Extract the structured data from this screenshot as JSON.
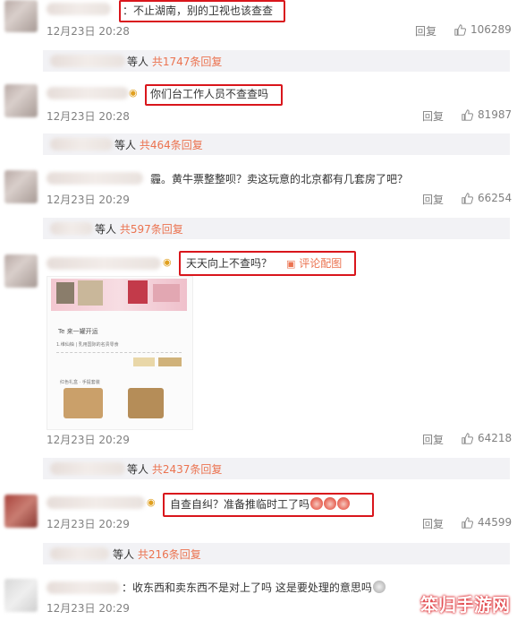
{
  "comments": [
    {
      "text": "：不止湖南，别的卫视也该查查",
      "time": "12月23日 20:28",
      "reply": "回复",
      "likes": "106289",
      "sub": {
        "suffix": "等人",
        "count": "共1747条回复"
      }
    },
    {
      "text": "你们台工作人员不查查吗",
      "time": "12月23日 20:28",
      "reply": "回复",
      "likes": "81987",
      "sub": {
        "suffix": "等人",
        "count": "共464条回复"
      }
    },
    {
      "text": "霾。黄牛票整整呗？卖这玩意的北京都有几套房了吧？",
      "time": "12月23日 20:29",
      "reply": "回复",
      "likes": "66254",
      "sub": {
        "suffix": "等人",
        "count": "共597条回复"
      }
    },
    {
      "text": "天天向上不查吗？",
      "image_link": "评论配图",
      "time": "12月23日 20:29",
      "reply": "回复",
      "likes": "64218",
      "sub": {
        "suffix": "等人",
        "count": "共2437条回复"
      }
    },
    {
      "text": "自查自纠？准备推临时工了吗",
      "time": "12月23日 20:29",
      "reply": "回复",
      "likes": "44599",
      "sub": {
        "suffix": "等人",
        "count": "共216条回复"
      }
    },
    {
      "text": "：收东西和卖东西不是对上了吗 这是要处理的意思吗",
      "time": "12月23日 20:29"
    }
  ],
  "attached_image": {
    "heading": "Te 来一罐开运",
    "row1": "1.维仙柚 | 乳用国际的名贵零食",
    "row2": "红色礼盒 · 手提套装"
  },
  "watermark": "笨归手游网",
  "colors": {
    "highlight": "#d9161c",
    "accent": "#eb7350"
  }
}
